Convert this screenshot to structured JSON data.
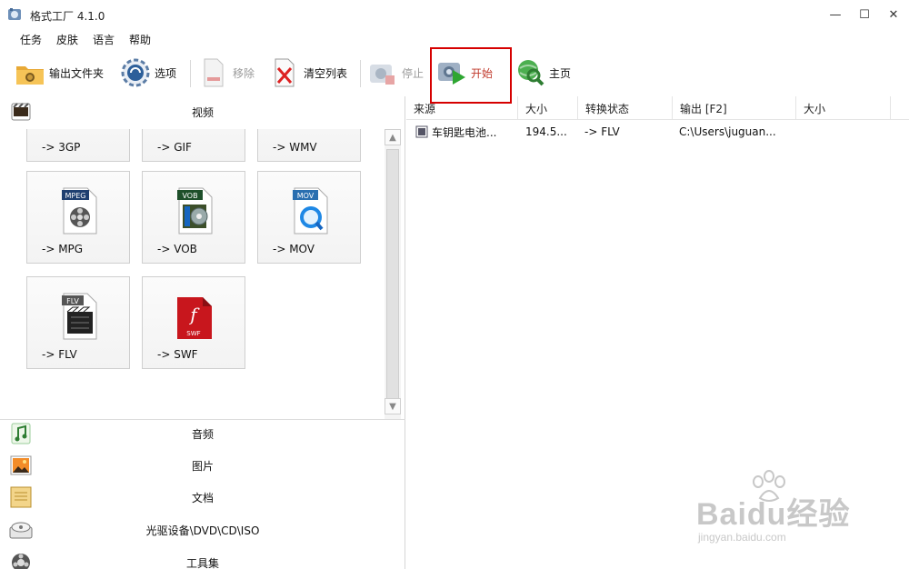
{
  "window": {
    "title": "格式工厂 4.1.0",
    "controls": {
      "minimize": "—",
      "maximize": "☐",
      "close": "✕"
    }
  },
  "menu": [
    "任务",
    "皮肤",
    "语言",
    "帮助"
  ],
  "toolbar": {
    "output_folder": "输出文件夹",
    "options": "选项",
    "remove": "移除",
    "clear_list": "清空列表",
    "stop": "停止",
    "start": "开始",
    "home": "主页"
  },
  "categories": {
    "video": "视频",
    "audio": "音频",
    "image": "图片",
    "document": "文档",
    "optical": "光驱设备\\DVD\\CD\\ISO",
    "tools": "工具集"
  },
  "video_formats": {
    "row0": [
      "-> 3GP",
      "-> GIF",
      "-> WMV"
    ],
    "row1": [
      "-> MPG",
      "-> VOB",
      "-> MOV"
    ],
    "row2": [
      "-> FLV",
      "-> SWF"
    ],
    "badges": {
      "mpg": "MPEG",
      "vob": "VOB",
      "mov": "MOV",
      "flv": "FLV",
      "swf": "SWF"
    }
  },
  "task_list": {
    "columns": [
      "来源",
      "大小",
      "转换状态",
      "输出 [F2]",
      "大小"
    ],
    "rows": [
      {
        "source": "车钥匙电池...",
        "size": "194.5...",
        "status": "-> FLV",
        "output": "C:\\Users\\juguan...",
        "out_size": ""
      }
    ]
  },
  "watermark": {
    "main": "Baidu经验",
    "sub": "jingyan.baidu.com"
  },
  "colors": {
    "highlight": "#d60000",
    "accent_red": "#c0392b",
    "flv_bg": "#222222",
    "swf_red": "#c8161d"
  }
}
